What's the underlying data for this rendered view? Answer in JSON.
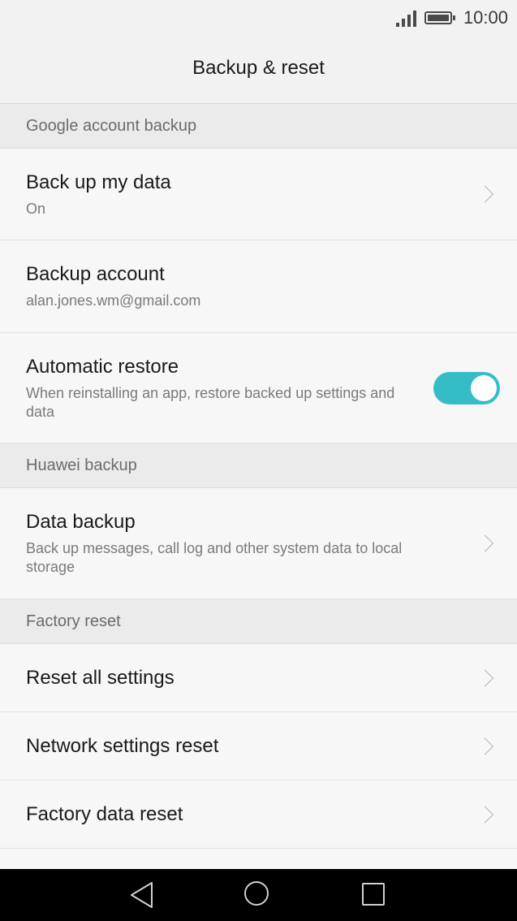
{
  "status_bar": {
    "time": "10:00",
    "signal_icon": "signal-bars-icon",
    "battery_icon": "battery-full-icon"
  },
  "header": {
    "title": "Backup & reset"
  },
  "sections": {
    "google": {
      "header": "Google account backup",
      "back_up_my_data": {
        "title": "Back up my data",
        "subtitle": "On"
      },
      "backup_account": {
        "title": "Backup account",
        "subtitle": "alan.jones.wm@gmail.com"
      },
      "automatic_restore": {
        "title": "Automatic restore",
        "subtitle": "When reinstalling an app, restore backed up settings and data",
        "enabled": true
      }
    },
    "huawei": {
      "header": "Huawei backup",
      "data_backup": {
        "title": "Data backup",
        "subtitle": "Back up messages, call log and other system data to local storage"
      }
    },
    "factory": {
      "header": "Factory reset",
      "reset_all_settings": {
        "title": "Reset all settings"
      },
      "network_settings_reset": {
        "title": "Network settings reset"
      },
      "factory_data_reset": {
        "title": "Factory data reset"
      }
    }
  },
  "colors": {
    "accent": "#35bdc5",
    "background": "#f7f7f7",
    "section_header_bg": "#ebebeb",
    "nav_bar": "#000000"
  },
  "nav_bar": {
    "back_icon": "back-triangle-icon",
    "home_icon": "home-circle-icon",
    "recents_icon": "recents-square-icon"
  }
}
